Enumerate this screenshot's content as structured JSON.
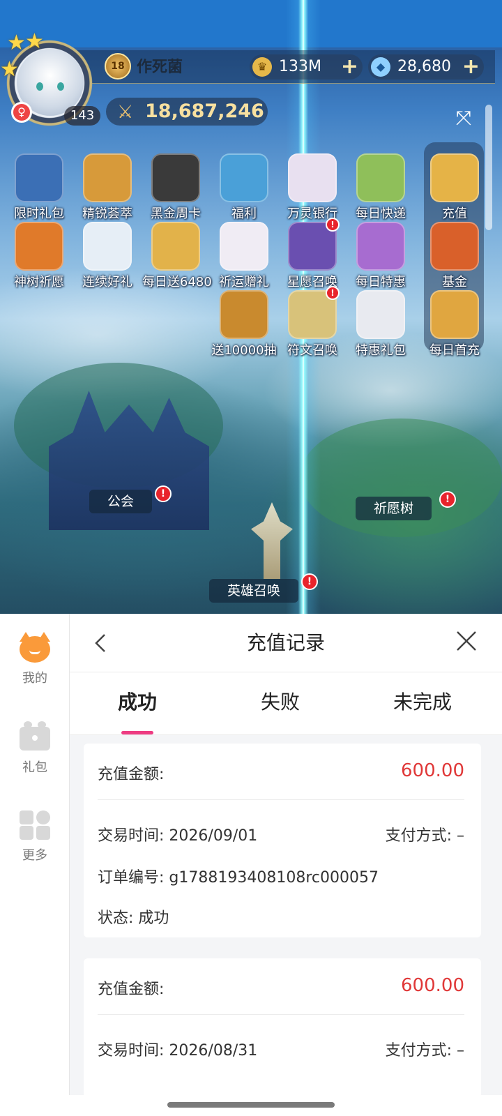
{
  "game": {
    "player": {
      "name": "作死菌",
      "vip_level": "18",
      "level": "143",
      "power": "18,687,246"
    },
    "resources": {
      "gold": "133M",
      "diamonds": "28,680"
    },
    "icons_row1": [
      {
        "label": "限时礼包",
        "color": "#3b6fb5"
      },
      {
        "label": "精锐荟萃",
        "color": "#d79a3a"
      },
      {
        "label": "黑金周卡",
        "color": "#3a3a3a"
      },
      {
        "label": "福利",
        "color": "#4aa0d8"
      },
      {
        "label": "万灵银行",
        "color": "#e8e0f0"
      },
      {
        "label": "每日快递",
        "color": "#8fbf5a"
      },
      {
        "label": "充值",
        "color": "#e5b347"
      }
    ],
    "icons_row2": [
      {
        "label": "神树祈愿",
        "color": "#e07a2a"
      },
      {
        "label": "连续好礼",
        "color": "#e6eef6"
      },
      {
        "label": "每日送6480",
        "color": "#e2b24a"
      },
      {
        "label": "祈运赠礼",
        "color": "#f0ecf4"
      },
      {
        "label": "星愿召唤",
        "color": "#6a4fb0",
        "badge": "!"
      },
      {
        "label": "每日特惠",
        "color": "#a76cd0"
      },
      {
        "label": "基金",
        "color": "#d9602a"
      }
    ],
    "icons_row3": [
      {
        "label": "送10000抽",
        "color": "#c98a2e"
      },
      {
        "label": "符文召唤",
        "color": "#d8c27a",
        "badge": "!"
      },
      {
        "label": "特惠礼包",
        "color": "#e8eaf0"
      },
      {
        "label": "每日首充",
        "color": "#e0a640"
      }
    ],
    "map": {
      "guild": "公会",
      "wish_tree": "祈愿树",
      "hero_summon": "英雄召唤",
      "badge": "!"
    }
  },
  "sdk": {
    "sidebar": [
      {
        "label": "我的"
      },
      {
        "label": "礼包"
      },
      {
        "label": "更多"
      }
    ],
    "panel": {
      "title": "充值记录",
      "tabs": [
        "成功",
        "失败",
        "未完成"
      ],
      "records": [
        {
          "amount_label": "充值金额:",
          "amount": "600.00",
          "time_label": "交易时间:",
          "time": "2026/09/01",
          "pay_label": "支付方式:",
          "pay": "–",
          "order_label": "订单编号:",
          "order": "g1788193408108rc000057",
          "status_label": "状态:",
          "status": "成功"
        },
        {
          "amount_label": "充值金额:",
          "amount": "600.00",
          "time_label": "交易时间:",
          "time": "2026/08/31",
          "pay_label": "支付方式:",
          "pay": "–"
        }
      ]
    }
  }
}
